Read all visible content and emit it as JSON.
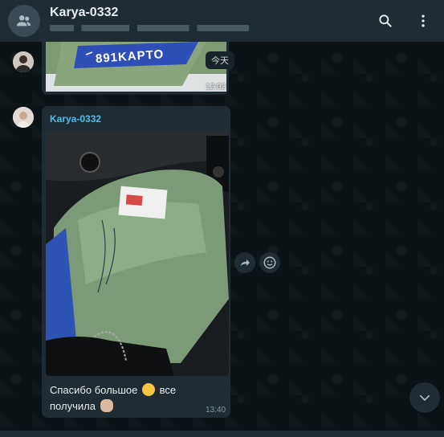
{
  "header": {
    "title": "Karya-0332",
    "subtitle": ""
  },
  "messages": [
    {
      "type": "image",
      "image_text": "891KAPTO",
      "date_chip": "今天",
      "time": "12:02"
    },
    {
      "type": "image_with_caption",
      "sender": "Karya-0332",
      "caption_part1": "Спасибо большое",
      "caption_part2": "все",
      "caption_part3": "получила",
      "time": "13:40"
    }
  ],
  "icons": {
    "group": "group-avatar-icon",
    "search": "search-icon",
    "menu": "more-vert-icon",
    "forward": "forward-icon",
    "react": "emoji-react-icon",
    "scroll": "chevron-down-icon"
  },
  "colors": {
    "header_bg": "#202c33",
    "bubble_bg": "#202c33",
    "sender_name": "#53bdeb"
  }
}
